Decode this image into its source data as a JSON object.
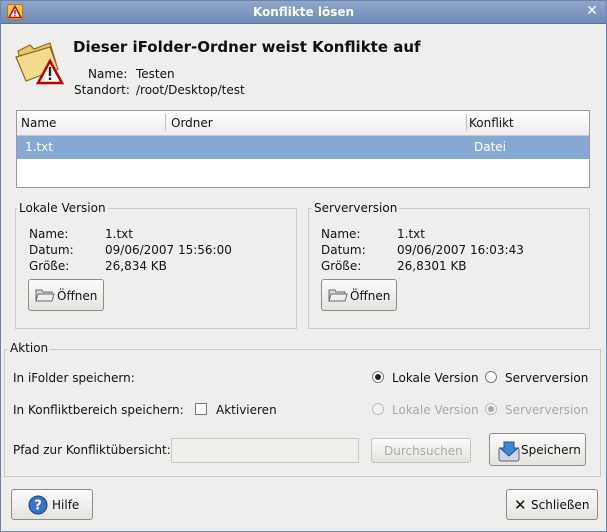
{
  "window": {
    "title": "Konflikte lösen"
  },
  "header": {
    "heading": "Dieser iFolder-Ordner weist Konflikte auf",
    "name_label": "Name:",
    "name_value": "Testen",
    "location_label": "Standort:",
    "location_value": "/root/Desktop/test"
  },
  "table": {
    "columns": [
      "Name",
      "Ordner",
      "Konflikt"
    ],
    "rows": [
      {
        "name": "1.txt",
        "folder": "",
        "conflict": "Datei"
      }
    ]
  },
  "local": {
    "title": "Lokale Version",
    "name_label": "Name:",
    "name": "1.txt",
    "date_label": "Datum:",
    "date": "09/06/2007 15:56:00",
    "size_label": "Größe:",
    "size": "26,834 KB",
    "open_button": "Öffnen"
  },
  "server": {
    "title": "Serverversion",
    "name_label": "Name:",
    "name": "1.txt",
    "date_label": "Datum:",
    "date": "09/06/2007 16:03:43",
    "size_label": "Größe:",
    "size": "26,8301 KB",
    "open_button": "Öffnen"
  },
  "action": {
    "title": "Aktion",
    "save_ifolder_label": "In iFolder speichern:",
    "save_ifolder_local": "Lokale Version",
    "save_ifolder_server": "Serverversion",
    "save_ifolder_selected": "Lokale Version",
    "save_conflict_label": "In Konfliktbereich speichern:",
    "activate_label": "Aktivieren",
    "activate_checked": false,
    "save_conflict_local": "Lokale Version",
    "save_conflict_server": "Serverversion",
    "save_conflict_selected": "Serverversion",
    "path_label": "Pfad zur Konfliktübersicht:",
    "path_value": "",
    "browse_button": "Durchsuchen",
    "save_button": "Speichern"
  },
  "footer": {
    "help_button": "Hilfe",
    "close_button": "Schließen"
  },
  "colors": {
    "titlebar": "#7891bb",
    "selection": "#86a9d4",
    "background": "#eeeeec"
  }
}
